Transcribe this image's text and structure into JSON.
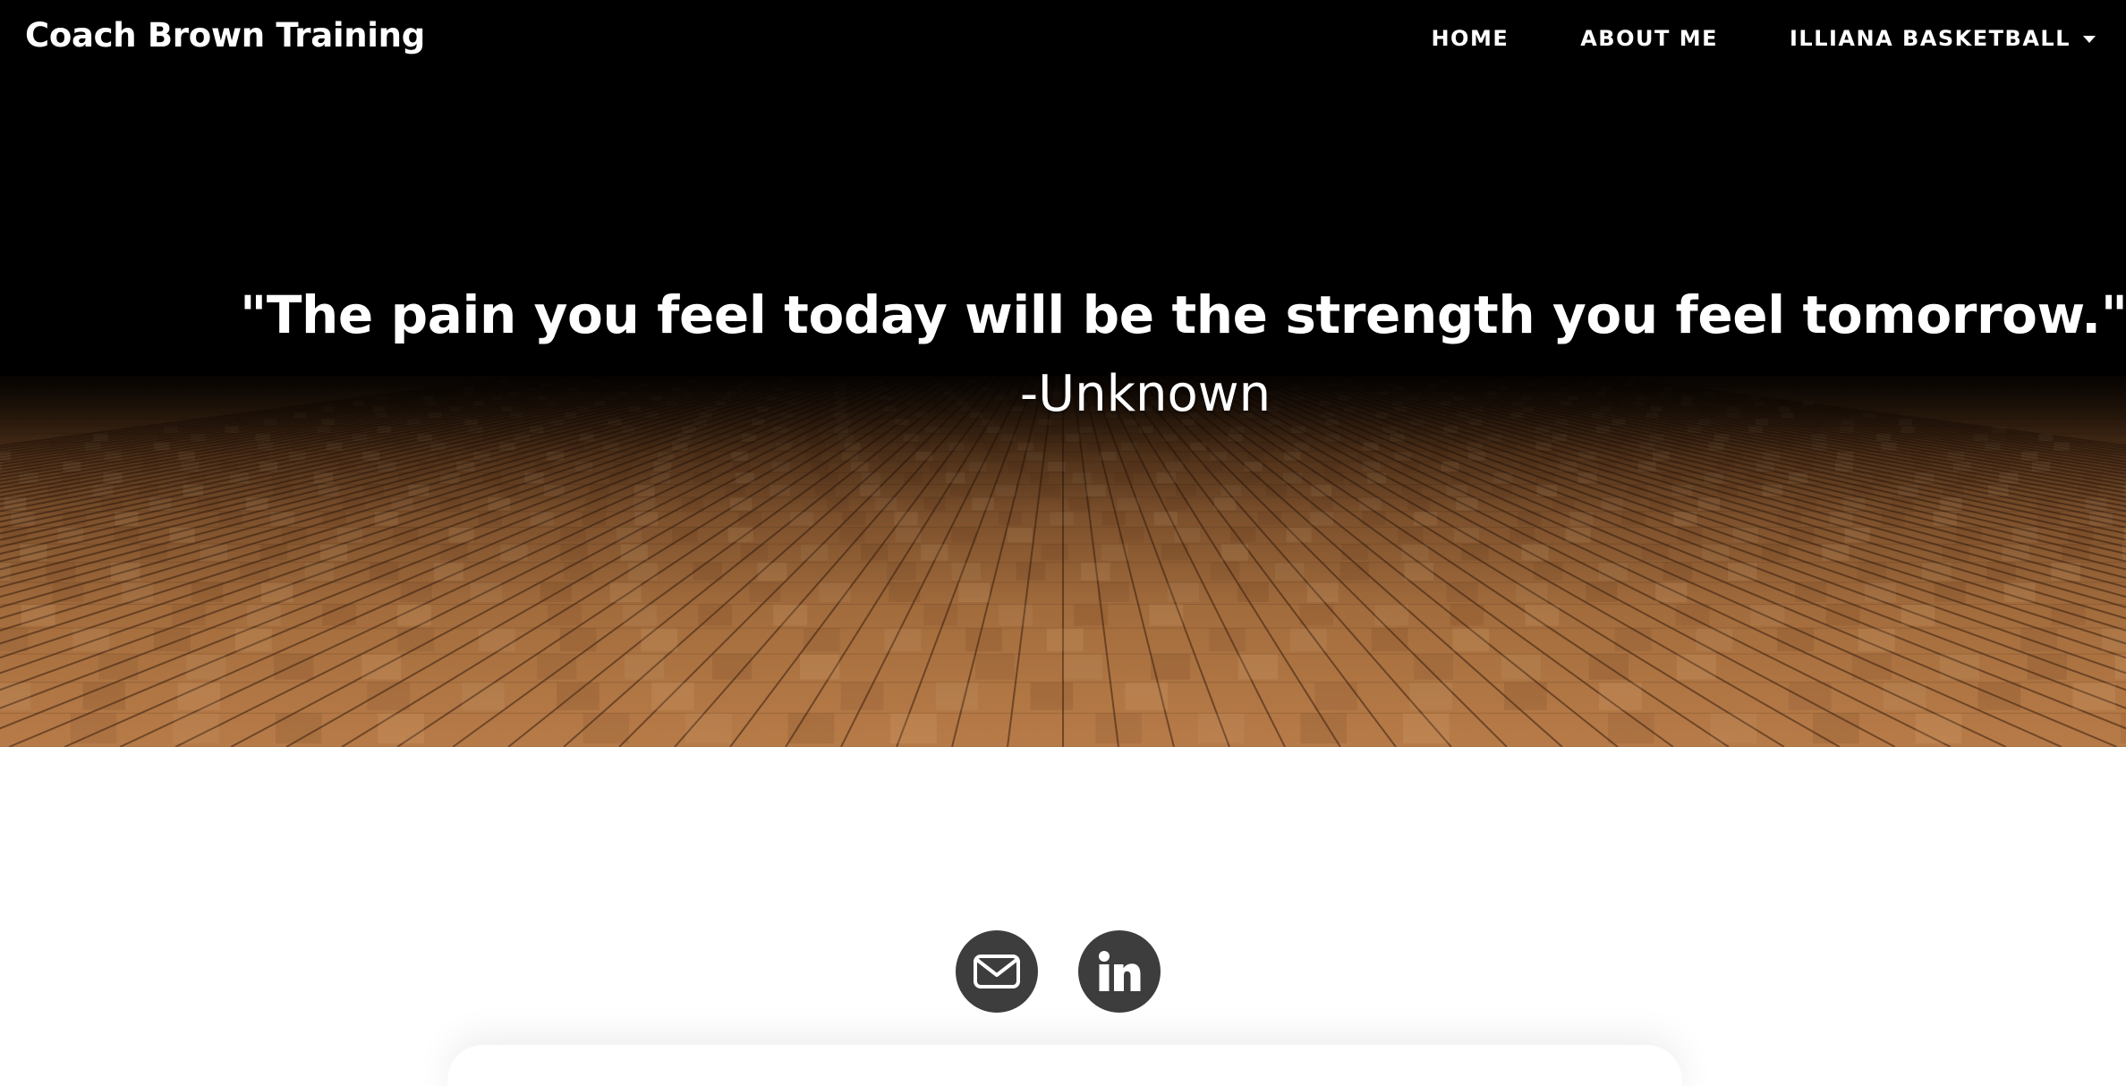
{
  "header": {
    "brand": "Coach Brown Training",
    "nav": {
      "home": "HOME",
      "about": "ABOUT ME",
      "illiana": "ILLIANA BASKETBALL"
    }
  },
  "hero": {
    "quote": "\"The pain you feel today will be the strength you feel tomorrow.\"",
    "attribution": "-Unknown",
    "background": "hardwood-basketball-court-floor"
  },
  "social": {
    "links": [
      {
        "icon": "envelope-icon"
      },
      {
        "icon": "linkedin-icon"
      }
    ]
  },
  "colors": {
    "nav_background": "#000000",
    "text_on_hero": "#ffffff",
    "social_button": "#3d3d3d",
    "floor_base": "#a86a3e",
    "page_background": "#ffffff"
  }
}
